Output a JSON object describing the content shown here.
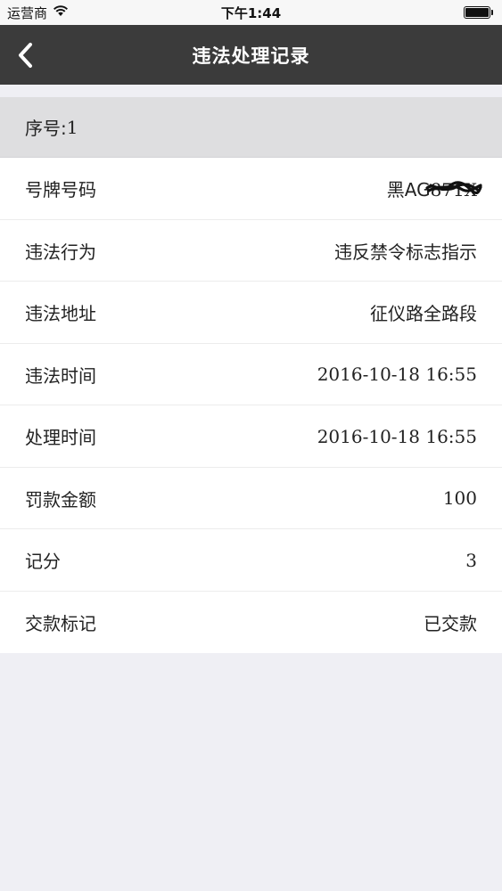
{
  "status_bar": {
    "carrier": "运营商",
    "time": "下午1:44",
    "wifi_icon": "wifi-icon",
    "battery_icon": "battery-icon",
    "battery_level": 1.0
  },
  "nav": {
    "title": "违法处理记录",
    "back_icon": "chevron-left-icon"
  },
  "record": {
    "header_label": "序号:",
    "header_value": "1",
    "rows": [
      {
        "label": "号牌号码",
        "value": "黑AG",
        "redacted": "871X"
      },
      {
        "label": "违法行为",
        "value": "违反禁令标志指示"
      },
      {
        "label": "违法地址",
        "value": "征仪路全路段"
      },
      {
        "label": "违法时间",
        "value": "2016-10-18 16:55"
      },
      {
        "label": "处理时间",
        "value": "2016-10-18 16:55"
      },
      {
        "label": "罚款金额",
        "value": "100"
      },
      {
        "label": "记分",
        "value": "3"
      },
      {
        "label": "交款标记",
        "value": "已交款"
      }
    ]
  },
  "colors": {
    "nav_background": "#3b3b3b",
    "page_background": "#efeff4",
    "header_background": "#dedee0"
  }
}
